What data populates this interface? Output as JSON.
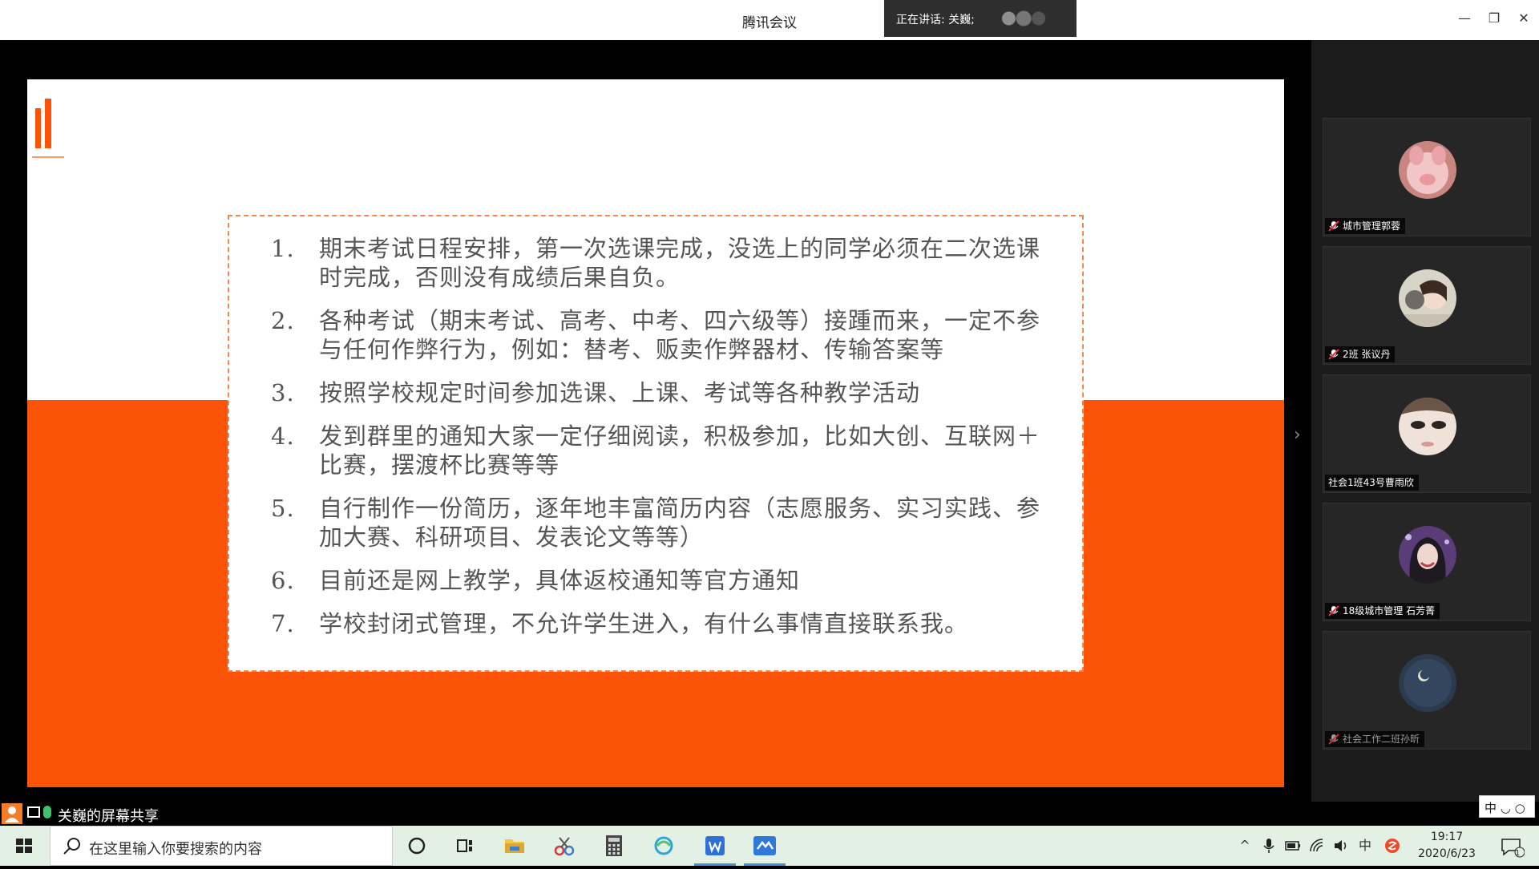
{
  "window": {
    "title": "腾讯会议",
    "speaker_banner": "正在讲话: 关巍;",
    "controls": {
      "minimize": "—",
      "restore": "❐",
      "close": "✕"
    }
  },
  "slide": {
    "items": [
      {
        "num": "1.",
        "text": "期末考试日程安排，第一次选课完成，没选上的同学必须在二次选课时完成，否则没有成绩后果自负。"
      },
      {
        "num": "2.",
        "text": "各种考试（期末考试、高考、中考、四六级等）接踵而来，一定不参与任何作弊行为，例如：替考、贩卖作弊器材、传输答案等"
      },
      {
        "num": "3.",
        "text": "按照学校规定时间参加选课、上课、考试等各种教学活动"
      },
      {
        "num": "4.",
        "text": "发到群里的通知大家一定仔细阅读，积极参加，比如大创、互联网＋比赛，摆渡杯比赛等等"
      },
      {
        "num": "5.",
        "text": "自行制作一份简历，逐年地丰富简历内容（志愿服务、实习实践、参加大赛、科研项目、发表论文等等）"
      },
      {
        "num": "6.",
        "text": "目前还是网上教学，具体返校通知等官方通知"
      },
      {
        "num": "7.",
        "text": "学校封闭式管理，不允许学生进入，有什么事情直接联系我。"
      }
    ]
  },
  "participants": [
    {
      "name": "城市管理郭蓉"
    },
    {
      "name": "2班 张议丹"
    },
    {
      "name": "社会1班43号曹雨欣"
    },
    {
      "name": "18级城市管理 石芳菁"
    },
    {
      "name": "社会工作二班孙昕"
    }
  ],
  "share_bar": {
    "label": "关巍的屏幕共享",
    "ime": "中 ◡ ○"
  },
  "taskbar": {
    "search_placeholder": "在这里输入你要搜索的内容",
    "time": "19:17",
    "date": "2020/6/23",
    "notification_count": "1",
    "ime_indicator": "中"
  },
  "colors": {
    "slide_orange": "#fb5308",
    "taskbar_bg": "#e3f0e4",
    "active_app_indicator": "#4a8fd9"
  }
}
